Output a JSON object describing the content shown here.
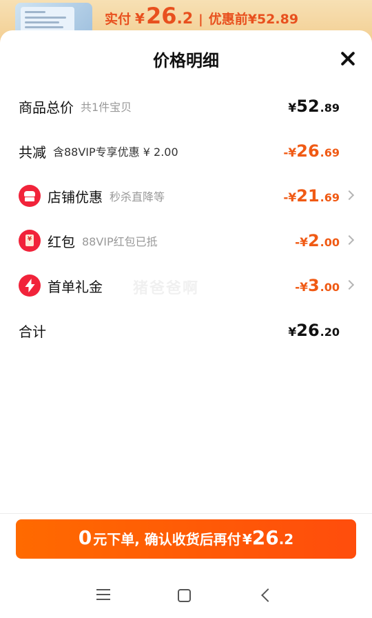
{
  "header_strip": {
    "paid_label": "实付",
    "paid_currency": "¥",
    "paid_int": "26",
    "paid_dec": ".2",
    "separator": "|",
    "before_label": "优惠前¥52.89"
  },
  "sheet": {
    "title": "价格明细",
    "close_icon": "close-icon"
  },
  "rows": [
    {
      "name": "商品总价",
      "sub": "共1件宝贝",
      "prefix": "¥",
      "int": "52",
      "dec": ".89",
      "color": "#111111"
    },
    {
      "name": "共减",
      "sub": "含88VIP专享优惠 ¥ 2.00",
      "prefix": "-¥",
      "int": "26",
      "dec": ".69",
      "color": "#f05a14"
    },
    {
      "name": "店铺优惠",
      "sub": "秒杀直降等",
      "prefix": "-¥",
      "int": "21",
      "dec": ".69",
      "color": "#f05a14",
      "icon": "shop-icon"
    },
    {
      "name": "红包",
      "sub": "88VIP红包已抵",
      "prefix": "-¥",
      "int": "2",
      "dec": ".00",
      "color": "#f05a14",
      "icon": "red-packet-icon"
    },
    {
      "name": "首单礼金",
      "sub": "",
      "prefix": "-¥",
      "int": "3",
      "dec": ".00",
      "color": "#f05a14",
      "icon": "lightning-icon"
    },
    {
      "name": "合计",
      "sub": "",
      "prefix": "¥",
      "int": "26",
      "dec": ".20",
      "color": "#111111"
    }
  ],
  "watermark": "猪爸爸啊",
  "cta": {
    "zero": "0",
    "text": "元下单, 确认收货后再付",
    "currency": "¥",
    "int": "26",
    "dec": ".2"
  },
  "colors": {
    "accent": "#ff5a0a",
    "discount": "#f05a14",
    "icon_red": "#f1233a"
  }
}
